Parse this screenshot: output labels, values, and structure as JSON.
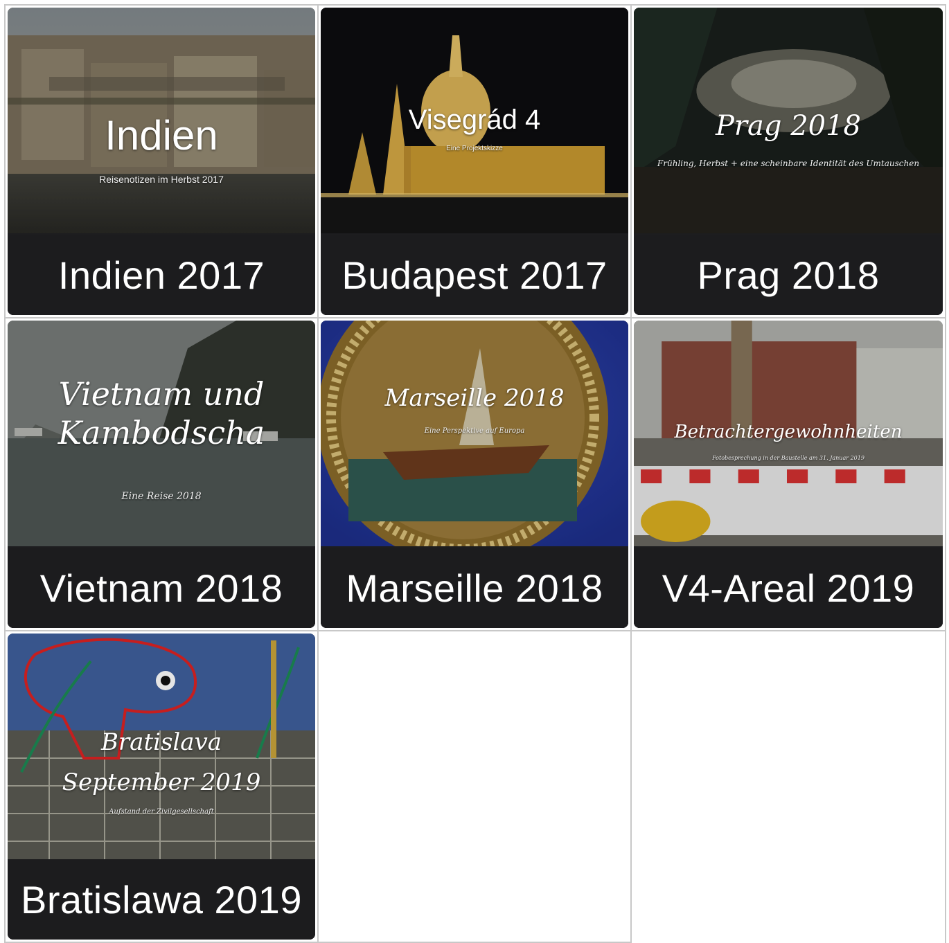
{
  "tiles": [
    {
      "caption": "Indien 2017",
      "overlay_title": "Indien",
      "overlay_subtitle": "Reisenotizen im Herbst 2017"
    },
    {
      "caption": "Budapest 2017",
      "overlay_title": "Visegrád 4",
      "overlay_subtitle": "Eine Projektskizze"
    },
    {
      "caption": "Prag 2018",
      "overlay_title": "Prag 2018",
      "overlay_subtitle": "Frühling, Herbst + eine scheinbare Identität des Umtauschen"
    },
    {
      "caption": "Vietnam 2018",
      "overlay_title_line1": "Vietnam und",
      "overlay_title_line2": "Kambodscha",
      "overlay_subtitle": "Eine Reise 2018"
    },
    {
      "caption": "Marseille 2018",
      "overlay_title": "Marseille 2018",
      "overlay_subtitle": "Eine Perspektive auf Europa"
    },
    {
      "caption": "V4-Areal 2019",
      "overlay_title": "Betrachtergewohnheiten",
      "overlay_subtitle": "Fotobesprechung in der Baustelle am 31. Januar 2019"
    },
    {
      "caption": "Bratislawa 2019",
      "overlay_title_line1": "Bratislava",
      "overlay_title_line2": "September 2019",
      "overlay_subtitle": "Aufstand der Zivilgesellschaft"
    }
  ]
}
